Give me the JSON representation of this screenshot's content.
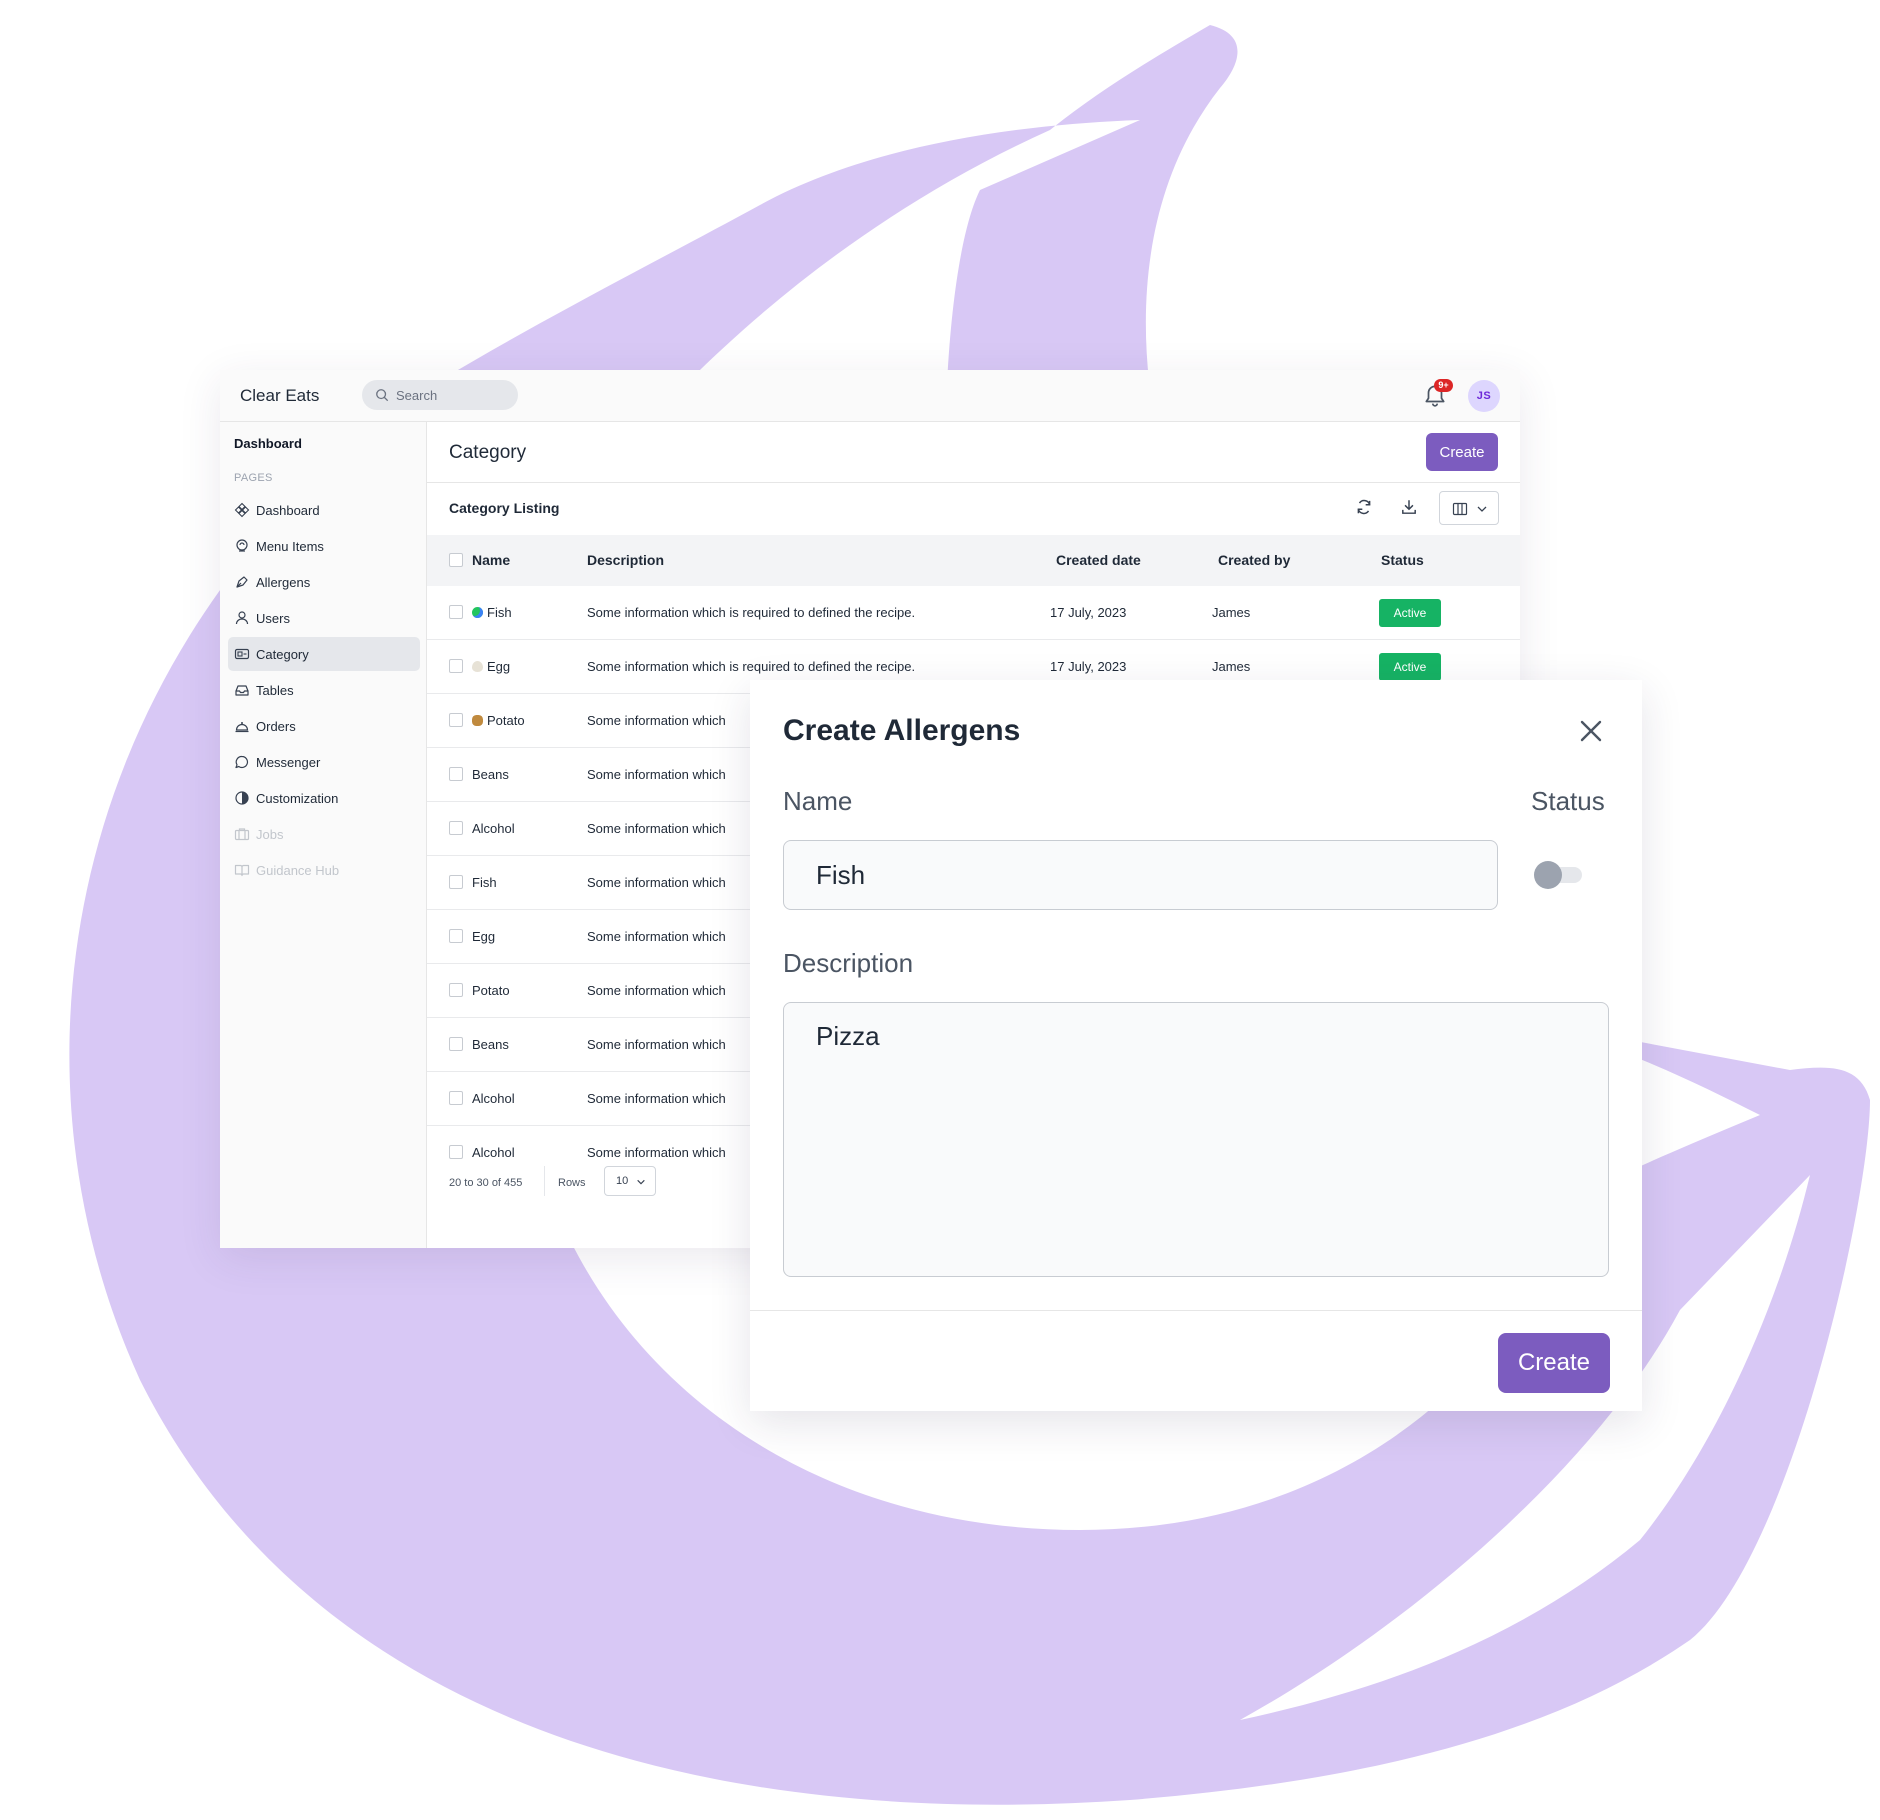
{
  "colors": {
    "accent": "#7c5cbf",
    "background_shape": "#d8c8f5",
    "status_active": "#16b364",
    "badge": "#dc2626"
  },
  "topbar": {
    "brand": "Clear Eats",
    "search_placeholder": "Search",
    "notification_badge": "9+",
    "avatar_initials": "JS"
  },
  "sidebar": {
    "heading": "Dashboard",
    "section_label": "PAGES",
    "items": [
      {
        "label": "Dashboard",
        "icon": "grid-icon"
      },
      {
        "label": "Menu Items",
        "icon": "chef-hat-icon"
      },
      {
        "label": "Allergens",
        "icon": "pen-tool-icon"
      },
      {
        "label": "Users",
        "icon": "user-icon"
      },
      {
        "label": "Category",
        "icon": "tag-card-icon",
        "active": true
      },
      {
        "label": "Tables",
        "icon": "inbox-tray-icon"
      },
      {
        "label": "Orders",
        "icon": "cloche-icon"
      },
      {
        "label": "Messenger",
        "icon": "chat-bubble-icon"
      },
      {
        "label": "Customization",
        "icon": "half-circle-icon"
      },
      {
        "label": "Jobs",
        "icon": "briefcase-icon",
        "disabled": true
      },
      {
        "label": "Guidance Hub",
        "icon": "book-icon",
        "disabled": true
      }
    ]
  },
  "main": {
    "page_title": "Category",
    "create_label": "Create",
    "listing_title": "Category Listing",
    "toolbar_icons": [
      "refresh-icon",
      "download-icon",
      "columns-icon"
    ],
    "table": {
      "columns": [
        "Name",
        "Description",
        "Created date",
        "Created by",
        "Status"
      ],
      "rows": [
        {
          "name": "Fish",
          "emoji": "fish",
          "description": "Some information which is required to defined the recipe.",
          "date": "17 July, 2023",
          "by": "James",
          "status": "Active"
        },
        {
          "name": "Egg",
          "emoji": "egg",
          "description": "Some information which is required to defined the recipe.",
          "date": "17 July, 2023",
          "by": "James",
          "status": "Active"
        },
        {
          "name": "Potato",
          "emoji": "potato",
          "description": "Some information which"
        },
        {
          "name": "Beans",
          "description": "Some information which"
        },
        {
          "name": "Alcohol",
          "description": "Some information which"
        },
        {
          "name": "Fish",
          "description": "Some information which"
        },
        {
          "name": "Egg",
          "description": "Some information which"
        },
        {
          "name": "Potato",
          "description": "Some information which"
        },
        {
          "name": "Beans",
          "description": "Some information which"
        },
        {
          "name": "Alcohol",
          "description": "Some information which"
        },
        {
          "name": "Alcohol",
          "description": "Some information which"
        }
      ]
    },
    "pagination": {
      "range": "20 to 30 of 455",
      "rows_label": "Rows",
      "rows_value": "10"
    }
  },
  "modal": {
    "title": "Create Allergens",
    "name_label": "Name",
    "name_value": "Fish",
    "status_label": "Status",
    "status_on": false,
    "description_label": "Description",
    "description_value": "Pizza",
    "create_label": "Create"
  }
}
